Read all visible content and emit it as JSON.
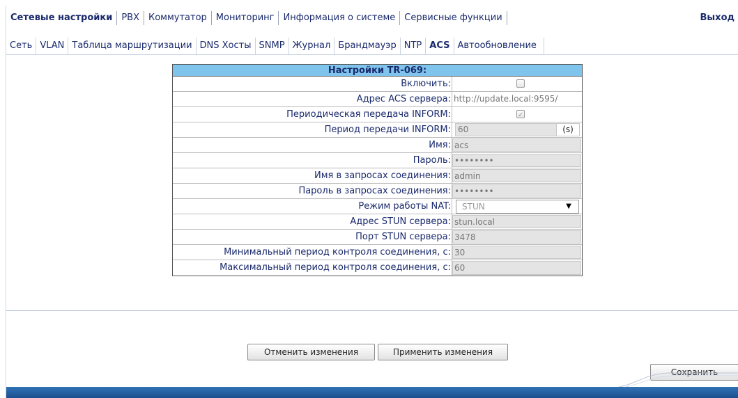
{
  "top_menu": {
    "items": [
      {
        "label": "Сетевые настройки",
        "active": true
      },
      {
        "label": "PBX",
        "active": false
      },
      {
        "label": "Коммутатор",
        "active": false
      },
      {
        "label": "Мониторинг",
        "active": false
      },
      {
        "label": "Информация о системе",
        "active": false
      },
      {
        "label": "Сервисные функции",
        "active": false
      }
    ],
    "exit_label": "Выход"
  },
  "sub_menu": {
    "items": [
      {
        "label": "Сеть",
        "active": false
      },
      {
        "label": "VLAN",
        "active": false
      },
      {
        "label": "Таблица маршрутизации",
        "active": false
      },
      {
        "label": "DNS Хосты",
        "active": false
      },
      {
        "label": "SNMP",
        "active": false
      },
      {
        "label": "Журнал",
        "active": false
      },
      {
        "label": "Брандмауэр",
        "active": false
      },
      {
        "label": "NTP",
        "active": false
      },
      {
        "label": "ACS",
        "active": true
      },
      {
        "label": "Автообновление",
        "active": false
      }
    ]
  },
  "tr069": {
    "title": "Настройки TR-069:",
    "enable_label": "Включить:",
    "enable_checked": false,
    "acs_address_label": "Адрес ACS сервера:",
    "acs_address_value": "http://update.local:9595/",
    "periodic_inform_label": "Периодическая передача INFORM:",
    "periodic_inform_checked": true,
    "inform_period_label": "Период передачи INFORM:",
    "inform_period_value": "60",
    "inform_period_unit": "(s)",
    "username_label": "Имя:",
    "username_value": "acs",
    "password_label": "Пароль:",
    "password_value": "••••••••",
    "conn_request_user_label": "Имя в запросах соединения:",
    "conn_request_user_value": "admin",
    "conn_request_password_label": "Пароль в запросах соединения:",
    "conn_request_password_value": "••••••••",
    "nat_mode_label": "Режим работы NAT:",
    "nat_mode_value": "STUN",
    "stun_address_label": "Адрес STUN сервера:",
    "stun_address_value": "stun.local",
    "stun_port_label": "Порт STUN сервера:",
    "stun_port_value": "3478",
    "min_keepalive_label": "Минимальный период контроля соединения, с:",
    "min_keepalive_value": "30",
    "max_keepalive_label": "Максимальный период контроля соединения, с:",
    "max_keepalive_value": "60"
  },
  "buttons": {
    "cancel": "Отменить изменения",
    "apply": "Применить изменения",
    "save": "Сохранить"
  },
  "colors": {
    "header_bg": "#7fc4ec",
    "menu_text": "#1a2a6c",
    "bottom_bar": "#2f73b5"
  }
}
